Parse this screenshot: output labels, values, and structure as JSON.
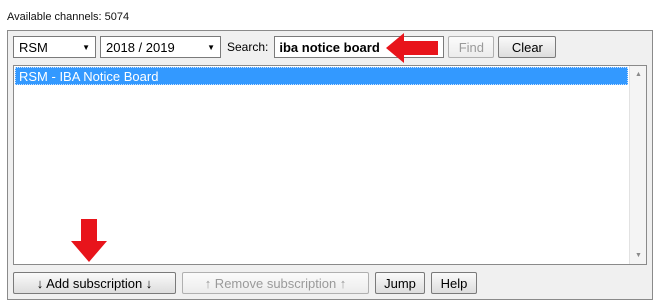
{
  "header": {
    "available_channels": "Available channels: 5074"
  },
  "toolbar": {
    "course_select": "RSM",
    "year_select": "2018 / 2019",
    "search_label": "Search:",
    "search_value": "iba notice board",
    "find_label": "Find",
    "clear_label": "Clear"
  },
  "list": {
    "items": [
      {
        "label": "RSM - IBA Notice Board",
        "selected": true
      }
    ]
  },
  "actions": {
    "add_label": "↓ Add subscription ↓",
    "remove_label": "↑ Remove subscription ↑",
    "jump_label": "Jump",
    "help_label": "Help"
  },
  "annotations": {
    "arrow_color": "#e8141b"
  },
  "colors": {
    "selection": "#3399ff"
  },
  "icons": {
    "dropdown": "chevron-down-icon",
    "arrows": "red-arrow-icon"
  }
}
